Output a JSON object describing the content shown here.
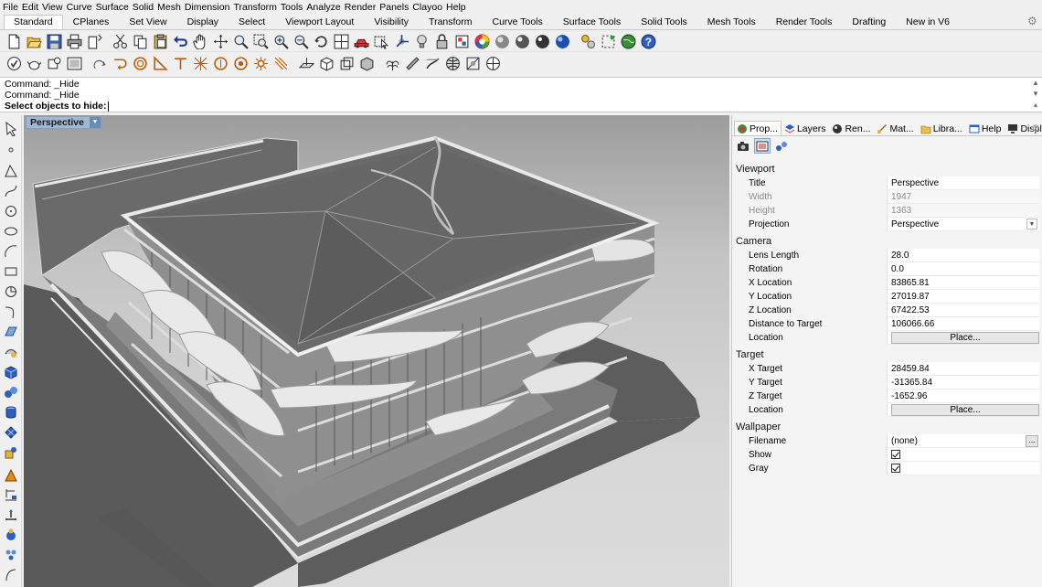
{
  "menu": [
    "File",
    "Edit",
    "View",
    "Curve",
    "Surface",
    "Solid",
    "Mesh",
    "Dimension",
    "Transform",
    "Tools",
    "Analyze",
    "Render",
    "Panels",
    "Clayoo",
    "Help"
  ],
  "tabs": [
    "Standard",
    "CPlanes",
    "Set View",
    "Display",
    "Select",
    "Viewport Layout",
    "Visibility",
    "Transform",
    "Curve Tools",
    "Surface Tools",
    "Solid Tools",
    "Mesh Tools",
    "Render Tools",
    "Drafting",
    "New in V6"
  ],
  "active_tab": "Standard",
  "command": {
    "history": [
      "Command: _Hide",
      "Command: _Hide"
    ],
    "prompt": "Select objects to hide:"
  },
  "viewport": {
    "title": "Perspective"
  },
  "panel": {
    "tabs": [
      "Prop...",
      "Layers",
      "Ren...",
      "Mat...",
      "Libra...",
      "Help",
      "Displ..."
    ],
    "sections": {
      "viewport": {
        "header": "Viewport",
        "title_label": "Title",
        "title_value": "Perspective",
        "width_label": "Width",
        "width_value": "1947",
        "height_label": "Height",
        "height_value": "1363",
        "projection_label": "Projection",
        "projection_value": "Perspective"
      },
      "camera": {
        "header": "Camera",
        "lens_label": "Lens Length",
        "lens_value": "28.0",
        "rotation_label": "Rotation",
        "rotation_value": "0.0",
        "xloc_label": "X Location",
        "xloc_value": "83865.81",
        "yloc_label": "Y Location",
        "yloc_value": "27019.87",
        "zloc_label": "Z Location",
        "zloc_value": "67422.53",
        "dist_label": "Distance to Target",
        "dist_value": "106066.66",
        "location_label": "Location",
        "place_label": "Place..."
      },
      "target": {
        "header": "Target",
        "xt_label": "X Target",
        "xt_value": "28459.84",
        "yt_label": "Y Target",
        "yt_value": "-31365.84",
        "zt_label": "Z Target",
        "zt_value": "-1652.96",
        "location_label": "Location",
        "place_label": "Place..."
      },
      "wallpaper": {
        "header": "Wallpaper",
        "filename_label": "Filename",
        "filename_value": "(none)",
        "show_label": "Show",
        "show_checked": true,
        "gray_label": "Gray",
        "gray_checked": true,
        "browse_label": "..."
      }
    }
  }
}
